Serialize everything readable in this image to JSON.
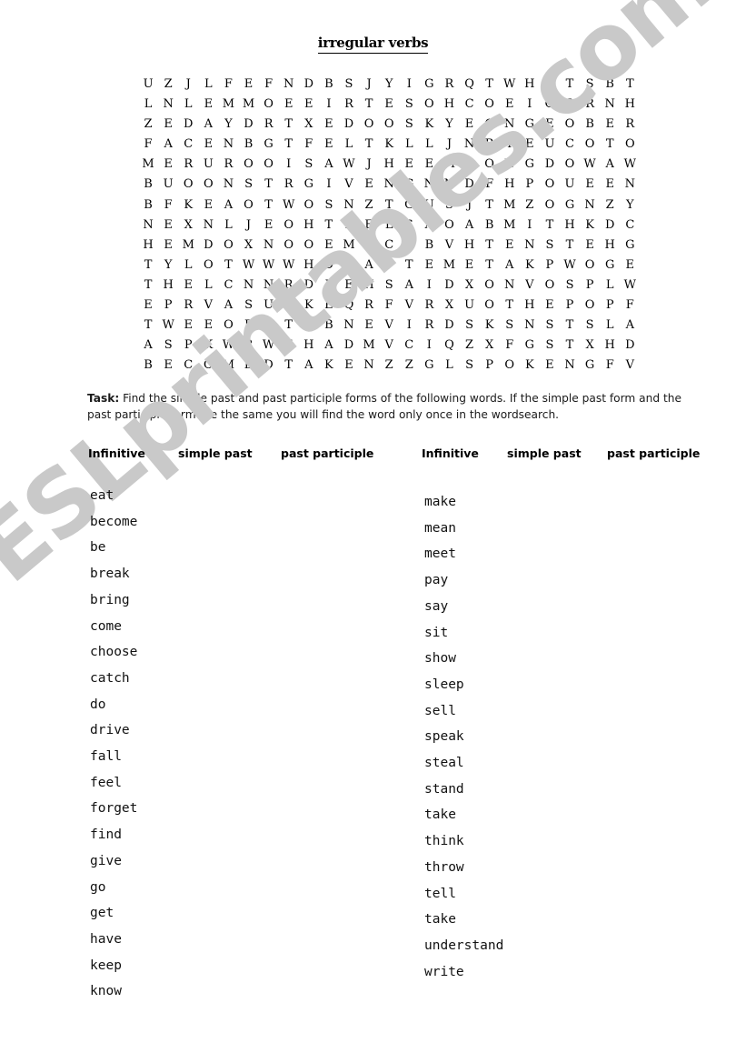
{
  "document": {
    "title": "irregular verbs",
    "watermark": "ESLprintables.com"
  },
  "task": {
    "label": "Task:",
    "text": " Find the simple past and past participle forms of the following words. If the simple past form and the past participle form are the same you will find the word only once in the wordsearch."
  },
  "headers": [
    "Infinitive",
    "simple past",
    "past participle",
    "Infinitive",
    "simple past",
    "past participle"
  ],
  "wordsearch": {
    "rows": 15,
    "cols": 26,
    "grid": [
      "UZJLFEFNDBSJYIGRQTWHETSBT",
      "LNLEMMOEEIRTESOHCOEIOBRNH",
      "ZEDAYDRTXEDOOSKYEGNGEOBER",
      "FACENBGTFELTKLLJNRTEUCOTO",
      "MERUROOISAWJHEEMOONGDOWAW",
      "BUOONSTRGIVENGNNDFHPOUEEN",
      "BFKEAOTWOSNZTGUSJTMZOGNZY",
      "NEXNLJEOHTPELSAOABMITHKDC",
      "HEMDOXNOOEMACRBVHTENSTEHG",
      "TYLOTWWWHDIAPTEMETAKPWOGE",
      "THELCNNRDLEHSAIDXONVOSPLW",
      "EPRVASUOKEQRFVRXUOTHEPOPF",
      "TWEEOFITVBNEVIRDSKSNSTSLA",
      "ASPKWRWEHADMVCIQZXFGSTXHD",
      "BECOMEDTAKENZZGLSPOKENGFV"
    ]
  },
  "verbs": {
    "left": [
      "eat",
      "become",
      "be",
      "break",
      "bring",
      "come",
      "choose",
      "catch",
      "do",
      "drive",
      "fall",
      "feel",
      "forget",
      "find",
      "give",
      "go",
      "get",
      "have",
      "keep",
      "know"
    ],
    "right": [
      "make",
      "mean",
      "meet",
      "pay",
      "say",
      "sit",
      "show",
      "sleep",
      "sell",
      "speak",
      "steal",
      "stand",
      "take",
      "think",
      "throw",
      "tell",
      "take",
      "understand",
      "write"
    ]
  },
  "colors": {
    "page_background": "#ffffff",
    "text": "#000000",
    "watermark": "#c9c9c9"
  }
}
